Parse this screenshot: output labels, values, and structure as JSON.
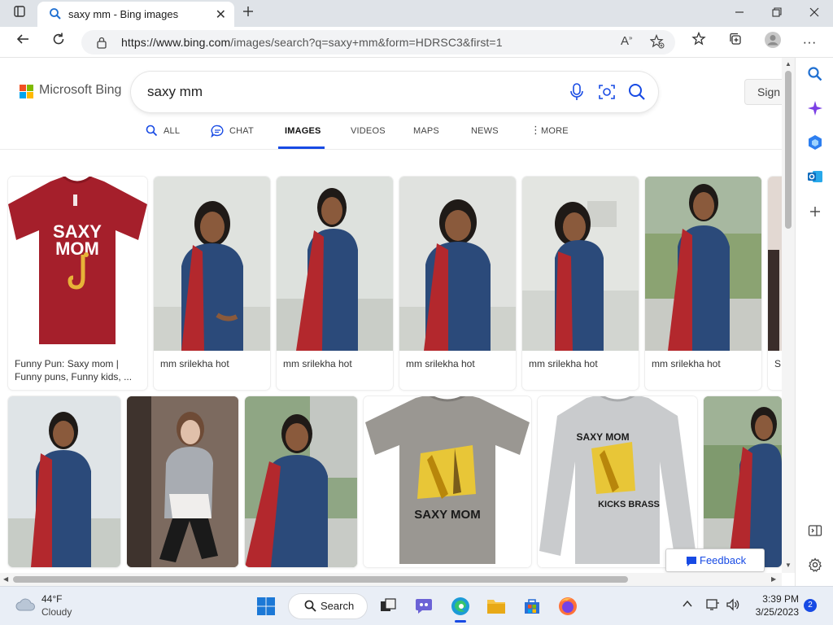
{
  "browser": {
    "tab_title": "saxy mm - Bing images",
    "url_main": "https://www.bing.com",
    "url_rest": "/images/search?q=saxy+mm&form=HDRSC3&first=1"
  },
  "bing": {
    "logo_text": "Microsoft Bing",
    "query": "saxy mm",
    "sign_in": "Sign",
    "nav": {
      "all": "ALL",
      "chat": "CHAT",
      "images": "IMAGES",
      "videos": "VIDEOS",
      "maps": "MAPS",
      "news": "NEWS",
      "more": "MORE"
    },
    "results_row1": [
      {
        "caption": "Funny Pun: Saxy mom | Funny puns, Funny kids, ...",
        "kind": "tshirt-red"
      },
      {
        "caption": "mm srilekha hot",
        "kind": "photo-woman"
      },
      {
        "caption": "mm srilekha hot",
        "kind": "photo-woman"
      },
      {
        "caption": "mm srilekha hot",
        "kind": "photo-woman"
      },
      {
        "caption": "mm srilekha hot",
        "kind": "photo-woman"
      },
      {
        "caption": "mm srilekha hot",
        "kind": "photo-woman"
      },
      {
        "caption": "S R",
        "kind": "partial"
      }
    ],
    "shirt_text": {
      "line1": "SAXY",
      "line2": "MOM"
    },
    "row2_texts": {
      "tee_text": "SAXY MOM",
      "sweat_line1": "SAXY MOM",
      "sweat_line2": "KICKS BRASS"
    },
    "feedback": "Feedback"
  },
  "taskbar": {
    "temperature": "44°F",
    "weather": "Cloudy",
    "search": "Search",
    "time": "3:39 PM",
    "date": "3/25/2023",
    "notifications": "2"
  },
  "colors": {
    "accent": "#174ae4",
    "dress_blue": "#2b4a7a",
    "dupatta_red": "#b3282d",
    "shirt_red": "#a51f2b"
  }
}
